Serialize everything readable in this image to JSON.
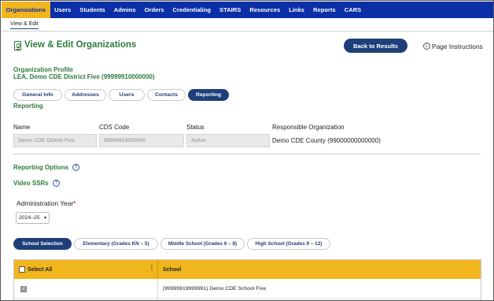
{
  "topnav": {
    "items": [
      "Organizations",
      "Users",
      "Students",
      "Admins",
      "Orders",
      "Credentialing",
      "STAIRS",
      "Resources",
      "Links",
      "Reports",
      "CARS"
    ],
    "active_index": 0,
    "brand_color": "#0b2fa6",
    "active_color": "#f1b51d"
  },
  "subnav": {
    "items": [
      "View & Edit"
    ]
  },
  "header": {
    "icon": "id-badge-icon",
    "title": "View & Edit Organizations",
    "back_button": "Back to Results",
    "instructions_icon": "info-icon",
    "instructions": "Page Instructions"
  },
  "org": {
    "profile_label": "Organization Profile",
    "name_line": "LEA, Demo CDE District Five (99999910000000)"
  },
  "tabs": {
    "items": [
      "General Info",
      "Addresses",
      "Users",
      "Contacts",
      "Reporting"
    ],
    "active_index": 4
  },
  "reporting": {
    "heading": "Reporting",
    "name_label": "Name",
    "name_value": "Demo CDE District Five",
    "cds_label": "CDS Code",
    "cds_value": "99999910000000",
    "status_label": "Status",
    "status_value": "Active",
    "resp_label": "Responsible Organization",
    "resp_value": "Demo CDE County (99000000000000)"
  },
  "options": {
    "heading": "Reporting Options",
    "video_heading": "Video SSRs",
    "help_icon": "question-circle-icon",
    "admin_year_label": "Administration Year",
    "required_mark": "*",
    "admin_year_value": "2024–25"
  },
  "school_filters": {
    "items": [
      "School Selection",
      "Elementary (Grades KN – 5)",
      "Middle School (Grades 6 – 8)",
      "High School (Grades 9 – 12)"
    ],
    "active_index": 0
  },
  "table": {
    "select_all_label": "Select All",
    "school_header": "School",
    "rows": [
      {
        "checked": true,
        "school": "(99999919999991) Demo CDE School Five"
      }
    ],
    "header_color": "#f1b51d"
  }
}
